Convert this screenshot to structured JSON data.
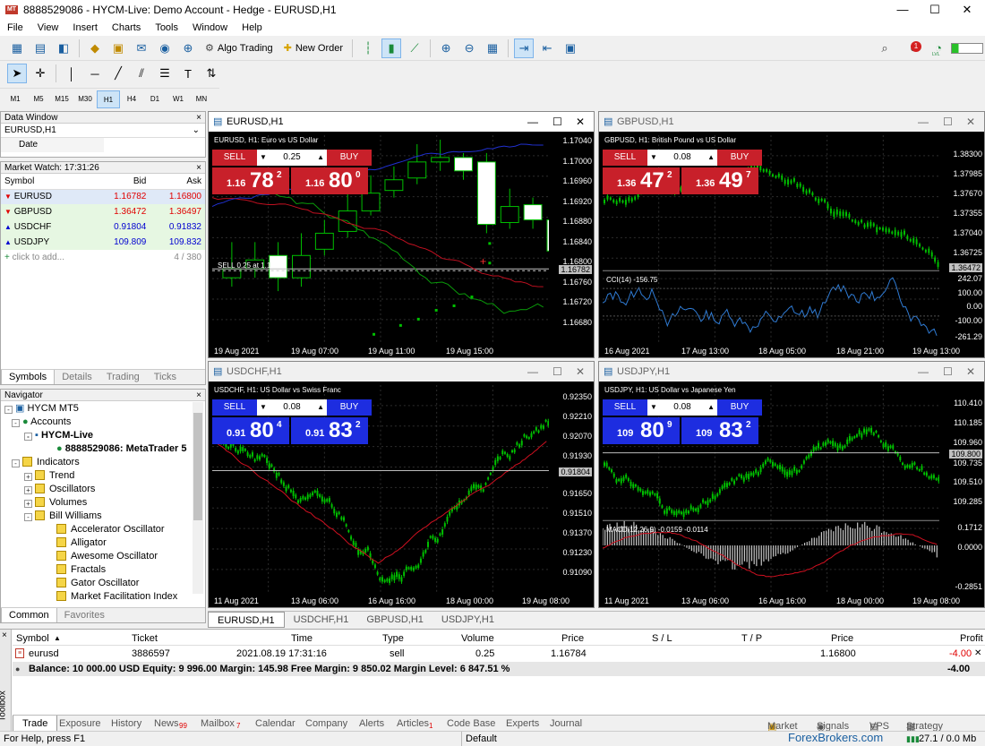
{
  "window": {
    "title": "8888529086 - HYCM-Live: Demo Account - Hedge - EURUSD,H1",
    "app_icon": "MT",
    "min": "—",
    "max": "☐",
    "close": "✕"
  },
  "menu": [
    "File",
    "View",
    "Insert",
    "Charts",
    "Tools",
    "Window",
    "Help"
  ],
  "toolbar": {
    "algo_trading": "Algo Trading",
    "new_order": "New Order",
    "notif_count": "1",
    "lvl_label": "LVL"
  },
  "timeframes": [
    "M1",
    "M5",
    "M15",
    "M30",
    "H1",
    "H4",
    "D1",
    "W1",
    "MN"
  ],
  "data_window": {
    "title": "Data Window",
    "symbol": "EURUSD,H1",
    "row_label": "Date",
    "close": "×"
  },
  "market_watch": {
    "title": "Market Watch: 17:31:26",
    "headers": {
      "symbol": "Symbol",
      "bid": "Bid",
      "ask": "Ask"
    },
    "rows": [
      {
        "symbol": "EURUSD",
        "bid": "1.16782",
        "ask": "1.16800"
      },
      {
        "symbol": "GBPUSD",
        "bid": "1.36472",
        "ask": "1.36497"
      },
      {
        "symbol": "USDCHF",
        "bid": "0.91804",
        "ask": "0.91832"
      },
      {
        "symbol": "USDJPY",
        "bid": "109.809",
        "ask": "109.832"
      }
    ],
    "add_label": "click to add...",
    "count": "4 / 380",
    "tabs": [
      "Symbols",
      "Details",
      "Trading",
      "Ticks"
    ]
  },
  "navigator": {
    "title": "Navigator",
    "items": [
      "HYCM MT5",
      "Accounts",
      "HYCM-Live",
      "8888529086: MetaTrader 5 I",
      "Indicators",
      "Trend",
      "Oscillators",
      "Volumes",
      "Bill Williams",
      "Accelerator Oscillator",
      "Alligator",
      "Awesome Oscillator",
      "Fractals",
      "Gator Oscillator",
      "Market Facilitation Index"
    ],
    "tabs": [
      "Common",
      "Favorites"
    ]
  },
  "charts": [
    {
      "title": "EURUSD,H1",
      "caption": "EURUSD, H1:  Euro vs US Dollar",
      "sell": "SELL",
      "buy": "BUY",
      "lot": "0.25",
      "sell_small": "1.16",
      "sell_big": "78",
      "sell_sup": "2",
      "buy_small": "1.16",
      "buy_big": "80",
      "buy_sup": "0",
      "prices": [
        "1.17040",
        "1.17000",
        "1.16960",
        "1.16920",
        "1.16880",
        "1.16840",
        "1.16800",
        "1.16782",
        "1.16760",
        "1.16720",
        "1.16680"
      ],
      "times": [
        "19 Aug 2021",
        "19 Aug 07:00",
        "19 Aug 11:00",
        "19 Aug 15:00"
      ],
      "order_line": "SELL 0.25 at 1.1678"
    },
    {
      "title": "GBPUSD,H1",
      "caption": "GBPUSD, H1:  British Pound vs US Dollar",
      "sell": "SELL",
      "buy": "BUY",
      "lot": "0.08",
      "sell_small": "1.36",
      "sell_big": "47",
      "sell_sup": "2",
      "buy_small": "1.36",
      "buy_big": "49",
      "buy_sup": "7",
      "prices": [
        "1.38300",
        "1.37985",
        "1.37670",
        "1.37355",
        "1.37040",
        "1.36725",
        "1.36472"
      ],
      "ind_prices": [
        "242.07",
        "100.00",
        "0.00",
        "-100.00",
        "-261.29"
      ],
      "ind_caption": "CCI(14) -156.75",
      "times": [
        "16 Aug 2021",
        "17 Aug 13:00",
        "18 Aug 05:00",
        "18 Aug 21:00",
        "19 Aug 13:00"
      ]
    },
    {
      "title": "USDCHF,H1",
      "caption": "USDCHF, H1:  US Dollar vs Swiss Franc",
      "sell": "SELL",
      "buy": "BUY",
      "lot": "0.08",
      "sell_small": "0.91",
      "sell_big": "80",
      "sell_sup": "4",
      "buy_small": "0.91",
      "buy_big": "83",
      "buy_sup": "2",
      "prices": [
        "0.92350",
        "0.92210",
        "0.92070",
        "0.91930",
        "0.91804",
        "0.91650",
        "0.91510",
        "0.91370",
        "0.91230",
        "0.91090"
      ],
      "times": [
        "11 Aug 2021",
        "13 Aug 06:00",
        "16 Aug 16:00",
        "18 Aug 00:00",
        "19 Aug 08:00"
      ]
    },
    {
      "title": "USDJPY,H1",
      "caption": "USDJPY, H1:  US Dollar vs Japanese Yen",
      "sell": "SELL",
      "buy": "BUY",
      "lot": "0.08",
      "sell_small": "109",
      "sell_big": "80",
      "sell_sup": "9",
      "buy_small": "109",
      "buy_big": "83",
      "buy_sup": "2",
      "prices": [
        "110.410",
        "110.185",
        "109.960",
        "109.800",
        "109.735",
        "109.510",
        "109.285"
      ],
      "ind_prices": [
        "0.1712",
        "0.0000",
        "-0.2851"
      ],
      "ind_caption": "MACD(12,26,9) -0.0159 -0.0114",
      "times": [
        "11 Aug 2021",
        "13 Aug 06:00",
        "16 Aug 16:00",
        "18 Aug 00:00",
        "19 Aug 08:00"
      ]
    }
  ],
  "chart_tabs": [
    "EURUSD,H1",
    "USDCHF,H1",
    "GBPUSD,H1",
    "USDJPY,H1"
  ],
  "toolbox": {
    "headers": {
      "symbol": "Symbol",
      "ticket": "Ticket",
      "time": "Time",
      "type": "Type",
      "volume": "Volume",
      "price": "Price",
      "sl": "S / L",
      "tp": "T / P",
      "price2": "Price",
      "profit": "Profit"
    },
    "row": {
      "symbol": "eurusd",
      "ticket": "3886597",
      "time": "2021.08.19 17:31:16",
      "type": "sell",
      "volume": "0.25",
      "price": "1.16784",
      "price2": "1.16800",
      "profit": "-4.00"
    },
    "balance": "Balance: 10 000.00 USD  Equity: 9 996.00  Margin: 145.98  Free Margin: 9 850.02  Margin Level: 6 847.51 %",
    "balance_profit": "-4.00",
    "side_label": "Toolbox",
    "tabs": [
      "Trade",
      "Exposure",
      "History",
      "News",
      "Mailbox",
      "Calendar",
      "Company",
      "Alerts",
      "Articles",
      "Code Base",
      "Experts",
      "Journal"
    ],
    "badges": {
      "news": "99",
      "mailbox": "7",
      "articles": "1"
    },
    "right_tabs": [
      "Market",
      "Signals",
      "VPS",
      "Strategy Tester"
    ]
  },
  "status": {
    "help": "For Help, press F1",
    "profile": "Default",
    "traffic": "27.1 / 0.0 Mb",
    "watermark": "ForexBrokers.com"
  },
  "colors": {
    "sell": "#c8202a",
    "buy_blue": "#1d2de0",
    "bull": "#00c000",
    "bear": "#ffffff",
    "grid": "#3a3a3a"
  }
}
